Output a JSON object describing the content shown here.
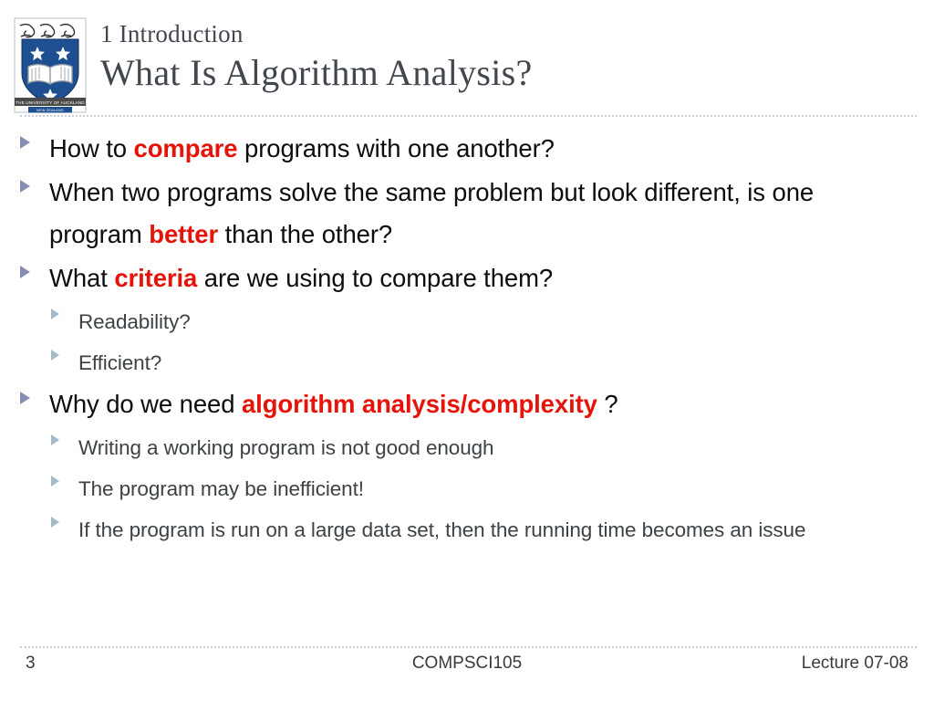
{
  "slide": {
    "logo": {
      "icon": "university-of-auckland-crest-icon",
      "institution_line": "THE UNIVERSITY OF AUCKLAND",
      "country_line": "NEW ZEALAND"
    },
    "header": {
      "section_label": "1 Introduction",
      "title": "What Is Algorithm Analysis?"
    },
    "bullets": [
      {
        "level": 1,
        "marker": "triangle-bullet-icon",
        "parts": [
          {
            "text": "How to ",
            "emphasis": false
          },
          {
            "text": "compare",
            "emphasis": true
          },
          {
            "text": " programs with one another?",
            "emphasis": false
          }
        ]
      },
      {
        "level": 1,
        "marker": "triangle-bullet-icon",
        "parts": [
          {
            "text": "When two programs solve the same problem but look different, is one program ",
            "emphasis": false
          },
          {
            "text": "better",
            "emphasis": true
          },
          {
            "text": " than the other?",
            "emphasis": false
          }
        ]
      },
      {
        "level": 1,
        "marker": "triangle-bullet-icon",
        "parts": [
          {
            "text": "What ",
            "emphasis": false
          },
          {
            "text": "criteria",
            "emphasis": true
          },
          {
            "text": " are we using to compare them?",
            "emphasis": false
          }
        ]
      },
      {
        "level": 2,
        "marker": "triangle-bullet-icon",
        "parts": [
          {
            "text": "Readability?",
            "emphasis": false
          }
        ]
      },
      {
        "level": 2,
        "marker": "triangle-bullet-icon",
        "parts": [
          {
            "text": "Efficient?",
            "emphasis": false
          }
        ]
      },
      {
        "level": 1,
        "marker": "triangle-bullet-icon",
        "parts": [
          {
            "text": "Why do we need ",
            "emphasis": false
          },
          {
            "text": "algorithm analysis/complexity",
            "emphasis": true
          },
          {
            "text": " ?",
            "emphasis": false
          }
        ]
      },
      {
        "level": 2,
        "marker": "triangle-bullet-icon",
        "parts": [
          {
            "text": "Writing a working program is not good enough",
            "emphasis": false
          }
        ]
      },
      {
        "level": 2,
        "marker": "triangle-bullet-icon",
        "parts": [
          {
            "text": "The program may be inefficient!",
            "emphasis": false
          }
        ]
      },
      {
        "level": 2,
        "marker": "triangle-bullet-icon",
        "parts": [
          {
            "text": "If the program is run on a large data set, then the running time becomes an issue",
            "emphasis": false
          }
        ]
      }
    ],
    "footer": {
      "page_number": "3",
      "course_code": "COMPSCI105",
      "lecture_label": "Lecture 07-08"
    },
    "colors": {
      "title": "#42474f",
      "body_level1": "#0d0d0d",
      "body_level2": "#3d4246",
      "emphasis_red": "#e51309",
      "bullet_level1": "#7d83ab",
      "bullet_level2": "#a3bacb",
      "rule": "#c9ccd4",
      "crest_blue": "#1d4f91",
      "background": "#ffffff"
    }
  }
}
